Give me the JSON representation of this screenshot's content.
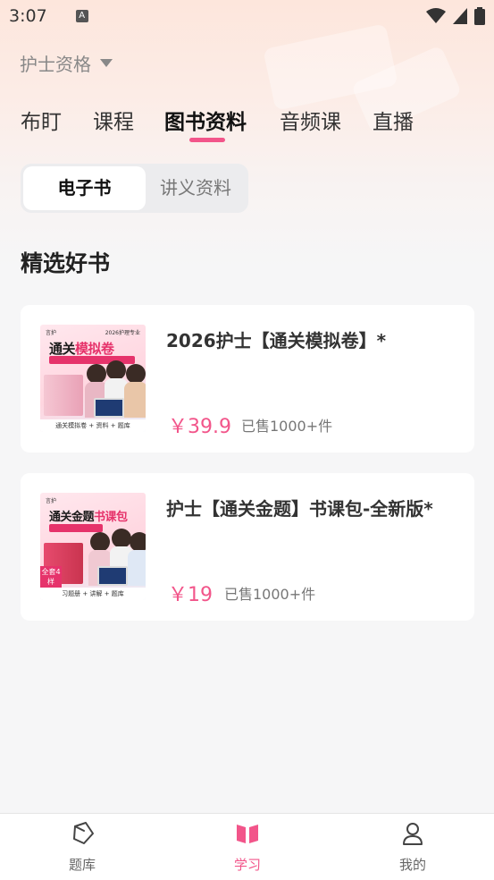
{
  "status_bar": {
    "time": "3:07",
    "notification_icon": "a-notification-icon",
    "wifi_icon": "wifi-icon",
    "signal_icon": "signal-icon",
    "battery_icon": "battery-icon"
  },
  "exam_selector": {
    "label": "护士资格",
    "icon": "caret-down-icon"
  },
  "tabs": [
    {
      "label": "布盯",
      "active": false
    },
    {
      "label": "课程",
      "active": false
    },
    {
      "label": "图书资料",
      "active": true
    },
    {
      "label": "音频课",
      "active": false
    },
    {
      "label": "直播",
      "active": false
    }
  ],
  "segment": {
    "options": [
      {
        "label": "电子书",
        "active": true
      },
      {
        "label": "讲义资料",
        "active": false
      }
    ]
  },
  "section": {
    "title": "精选好书"
  },
  "books": [
    {
      "title": "2026护士【通关模拟卷】*",
      "price": "￥39.9",
      "sold": "已售1000+件",
      "cover": {
        "head_left": "言护",
        "head_right": "2026护理专业",
        "title_plain": "通关",
        "title_highlight": "模拟卷",
        "footer": "通关模拟卷 + 资料 + 题库",
        "badge": ""
      }
    },
    {
      "title": "护士【通关金题】书课包-全新版*",
      "price": "￥19",
      "sold": "已售1000+件",
      "cover": {
        "head_left": "言护",
        "head_right": "",
        "title_plain": "通关金题",
        "title_highlight": "书课包",
        "footer": "习题册 + 讲解 + 题库",
        "badge": "全套4样"
      }
    }
  ],
  "colors": {
    "accent": "#f2558a",
    "background": "#f6f6f7",
    "header_gradient_top": "#fde6dc"
  },
  "bottom_nav": [
    {
      "label": "题库",
      "icon": "question-bank-icon",
      "active": false
    },
    {
      "label": "学习",
      "icon": "book-open-icon",
      "active": true
    },
    {
      "label": "我的",
      "icon": "user-icon",
      "active": false
    }
  ]
}
